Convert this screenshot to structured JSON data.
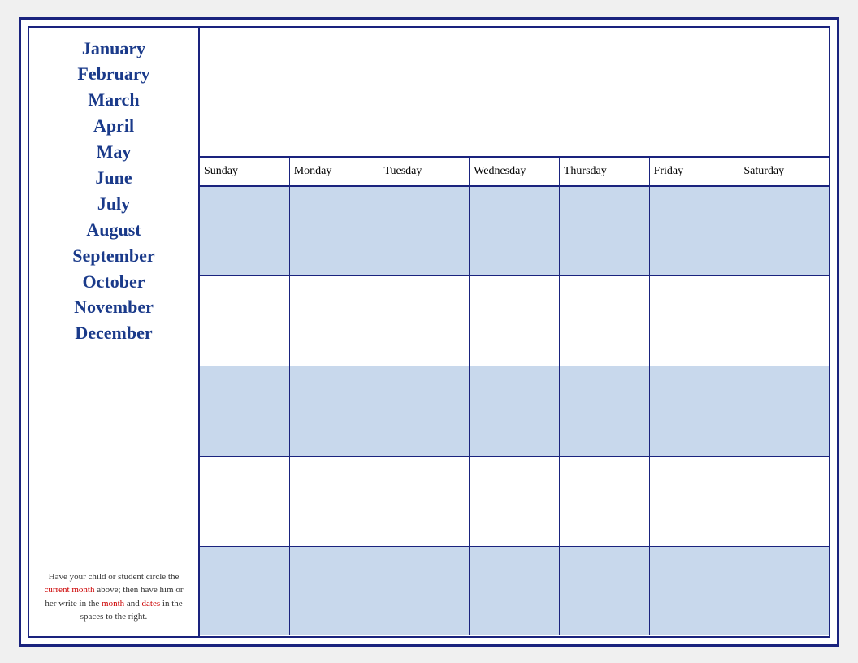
{
  "sidebar": {
    "months": [
      "January",
      "February",
      "March",
      "April",
      "May",
      "June",
      "July",
      "August",
      "September",
      "October",
      "November",
      "December"
    ],
    "note": {
      "part1": "Have your child or student circle the ",
      "highlight1": "current month",
      "part2": " above; then have him or her write in the ",
      "highlight2": "month",
      "part3": " and ",
      "highlight3": "dates",
      "part4": " in the spaces to the right."
    }
  },
  "calendar": {
    "days": [
      "Sunday",
      "Monday",
      "Tuesday",
      "Wednesday",
      "Thursday",
      "Friday",
      "Saturday"
    ],
    "rows": 5
  }
}
